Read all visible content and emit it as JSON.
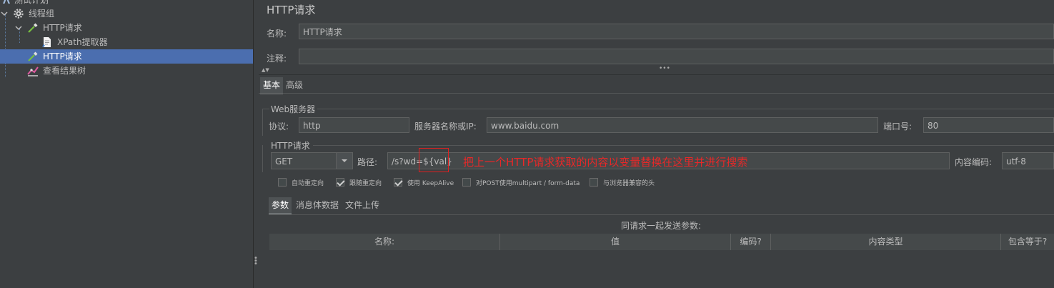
{
  "tree": {
    "root_label": "测试计划",
    "thread_group_label": "线程组",
    "http1_label": "HTTP请求",
    "xpath_label": "XPath提取器",
    "http2_label": "HTTP请求",
    "result_tree_label": "查看结果树"
  },
  "panel": {
    "title": "HTTP请求",
    "name_label": "名称:",
    "name_value": "HTTP请求",
    "comment_label": "注释:",
    "comment_value": "",
    "splitter_arrows": "▲▼",
    "splitter_grip": "•••",
    "tabs": [
      "基本",
      "高级"
    ]
  },
  "web_server": {
    "legend": "Web服务器",
    "protocol_label": "协议:",
    "protocol_value": "http",
    "server_label": "服务器名称或IP:",
    "server_value": "www.baidu.com",
    "port_label": "端口号:",
    "port_value": "80"
  },
  "http_request": {
    "legend": "HTTP请求",
    "method_value": "GET",
    "path_label": "路径:",
    "path_value": "/s?wd=${val}",
    "encoding_label": "内容编码:",
    "encoding_value": "utf-8"
  },
  "options": [
    {
      "label": "自动重定向",
      "checked": false
    },
    {
      "label": "跟随重定向",
      "checked": true
    },
    {
      "label": "使用 KeepAlive",
      "checked": true
    },
    {
      "label": "对POST使用multipart / form-data",
      "checked": false
    },
    {
      "label": "与浏览器兼容的头",
      "checked": false
    }
  ],
  "sub_tabs": [
    "参数",
    "消息体数据",
    "文件上传"
  ],
  "params": {
    "caption": "同请求一起发送参数:",
    "columns": [
      "名称:",
      "值",
      "编码?",
      "内容类型",
      "包含等于?"
    ]
  },
  "annotation": {
    "text": "把上一个HTTP请求获取的内容以变量替换在这里并进行搜索",
    "color": "#e82828"
  },
  "colors": {
    "background": "#3c3f41",
    "selection": "#4b6eaf",
    "field": "#45494a"
  }
}
